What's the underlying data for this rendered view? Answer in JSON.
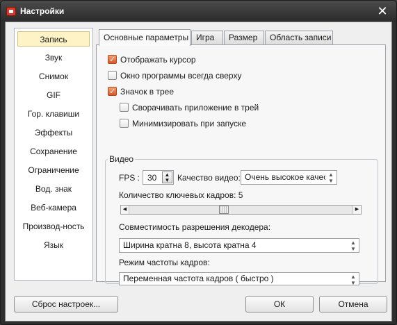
{
  "window": {
    "title": "Настройки"
  },
  "sidebar": {
    "items": [
      {
        "label": "Запись",
        "active": true
      },
      {
        "label": "Звук"
      },
      {
        "label": "Снимок"
      },
      {
        "label": "GIF"
      },
      {
        "label": "Гор. клавиши"
      },
      {
        "label": "Эффекты"
      },
      {
        "label": "Сохранение"
      },
      {
        "label": "Ограничение"
      },
      {
        "label": "Вод. знак"
      },
      {
        "label": "Веб-камера"
      },
      {
        "label": "Производ-ность"
      },
      {
        "label": "Язык"
      }
    ]
  },
  "tabs": [
    {
      "label": "Основные параметры",
      "active": true
    },
    {
      "label": "Игра"
    },
    {
      "label": "Размер"
    },
    {
      "label": "Область записи"
    }
  ],
  "options": {
    "show_cursor": {
      "label": "Отображать курсор",
      "checked": true
    },
    "always_on_top": {
      "label": "Окно программы всегда сверху",
      "checked": false
    },
    "tray_icon": {
      "label": "Значок в трее",
      "checked": true
    },
    "minimize_to_tray": {
      "label": "Сворачивать приложение в трей",
      "checked": false
    },
    "minimize_on_start": {
      "label": "Минимизировать при запуске",
      "checked": false
    }
  },
  "video": {
    "group_label": "Видео",
    "fps_label": "FPS :",
    "fps_value": "30",
    "quality_label": "Качество видео:",
    "quality_value": "Очень высокое качество",
    "keyframes_label": "Количество ключевых кадров: 5",
    "keyframes_level": 0.42,
    "decoder_label": "Совместимость разрешения декодера:",
    "decoder_value": "Ширина кратна 8, высота кратна 4",
    "framerate_label": "Режим частоты кадров:",
    "framerate_value": "Переменная частота кадров ( быстро )"
  },
  "buttons": {
    "reset": {
      "label": "Сброс настроек..."
    },
    "ok": {
      "label": "ОК"
    },
    "cancel": {
      "label": "Отмена"
    }
  }
}
